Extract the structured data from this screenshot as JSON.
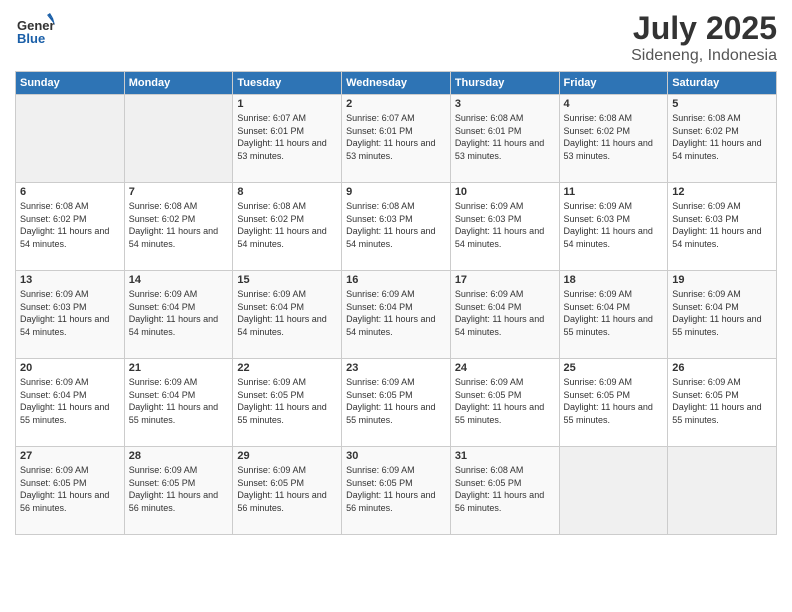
{
  "header": {
    "logo_general": "General",
    "logo_blue": "Blue",
    "title": "July 2025",
    "location": "Sideneng, Indonesia"
  },
  "days_of_week": [
    "Sunday",
    "Monday",
    "Tuesday",
    "Wednesday",
    "Thursday",
    "Friday",
    "Saturday"
  ],
  "weeks": [
    [
      {
        "day": "",
        "empty": true
      },
      {
        "day": "",
        "empty": true
      },
      {
        "day": "1",
        "sunrise": "Sunrise: 6:07 AM",
        "sunset": "Sunset: 6:01 PM",
        "daylight": "Daylight: 11 hours and 53 minutes."
      },
      {
        "day": "2",
        "sunrise": "Sunrise: 6:07 AM",
        "sunset": "Sunset: 6:01 PM",
        "daylight": "Daylight: 11 hours and 53 minutes."
      },
      {
        "day": "3",
        "sunrise": "Sunrise: 6:08 AM",
        "sunset": "Sunset: 6:01 PM",
        "daylight": "Daylight: 11 hours and 53 minutes."
      },
      {
        "day": "4",
        "sunrise": "Sunrise: 6:08 AM",
        "sunset": "Sunset: 6:02 PM",
        "daylight": "Daylight: 11 hours and 53 minutes."
      },
      {
        "day": "5",
        "sunrise": "Sunrise: 6:08 AM",
        "sunset": "Sunset: 6:02 PM",
        "daylight": "Daylight: 11 hours and 54 minutes."
      }
    ],
    [
      {
        "day": "6",
        "sunrise": "Sunrise: 6:08 AM",
        "sunset": "Sunset: 6:02 PM",
        "daylight": "Daylight: 11 hours and 54 minutes."
      },
      {
        "day": "7",
        "sunrise": "Sunrise: 6:08 AM",
        "sunset": "Sunset: 6:02 PM",
        "daylight": "Daylight: 11 hours and 54 minutes."
      },
      {
        "day": "8",
        "sunrise": "Sunrise: 6:08 AM",
        "sunset": "Sunset: 6:02 PM",
        "daylight": "Daylight: 11 hours and 54 minutes."
      },
      {
        "day": "9",
        "sunrise": "Sunrise: 6:08 AM",
        "sunset": "Sunset: 6:03 PM",
        "daylight": "Daylight: 11 hours and 54 minutes."
      },
      {
        "day": "10",
        "sunrise": "Sunrise: 6:09 AM",
        "sunset": "Sunset: 6:03 PM",
        "daylight": "Daylight: 11 hours and 54 minutes."
      },
      {
        "day": "11",
        "sunrise": "Sunrise: 6:09 AM",
        "sunset": "Sunset: 6:03 PM",
        "daylight": "Daylight: 11 hours and 54 minutes."
      },
      {
        "day": "12",
        "sunrise": "Sunrise: 6:09 AM",
        "sunset": "Sunset: 6:03 PM",
        "daylight": "Daylight: 11 hours and 54 minutes."
      }
    ],
    [
      {
        "day": "13",
        "sunrise": "Sunrise: 6:09 AM",
        "sunset": "Sunset: 6:03 PM",
        "daylight": "Daylight: 11 hours and 54 minutes."
      },
      {
        "day": "14",
        "sunrise": "Sunrise: 6:09 AM",
        "sunset": "Sunset: 6:04 PM",
        "daylight": "Daylight: 11 hours and 54 minutes."
      },
      {
        "day": "15",
        "sunrise": "Sunrise: 6:09 AM",
        "sunset": "Sunset: 6:04 PM",
        "daylight": "Daylight: 11 hours and 54 minutes."
      },
      {
        "day": "16",
        "sunrise": "Sunrise: 6:09 AM",
        "sunset": "Sunset: 6:04 PM",
        "daylight": "Daylight: 11 hours and 54 minutes."
      },
      {
        "day": "17",
        "sunrise": "Sunrise: 6:09 AM",
        "sunset": "Sunset: 6:04 PM",
        "daylight": "Daylight: 11 hours and 54 minutes."
      },
      {
        "day": "18",
        "sunrise": "Sunrise: 6:09 AM",
        "sunset": "Sunset: 6:04 PM",
        "daylight": "Daylight: 11 hours and 55 minutes."
      },
      {
        "day": "19",
        "sunrise": "Sunrise: 6:09 AM",
        "sunset": "Sunset: 6:04 PM",
        "daylight": "Daylight: 11 hours and 55 minutes."
      }
    ],
    [
      {
        "day": "20",
        "sunrise": "Sunrise: 6:09 AM",
        "sunset": "Sunset: 6:04 PM",
        "daylight": "Daylight: 11 hours and 55 minutes."
      },
      {
        "day": "21",
        "sunrise": "Sunrise: 6:09 AM",
        "sunset": "Sunset: 6:04 PM",
        "daylight": "Daylight: 11 hours and 55 minutes."
      },
      {
        "day": "22",
        "sunrise": "Sunrise: 6:09 AM",
        "sunset": "Sunset: 6:05 PM",
        "daylight": "Daylight: 11 hours and 55 minutes."
      },
      {
        "day": "23",
        "sunrise": "Sunrise: 6:09 AM",
        "sunset": "Sunset: 6:05 PM",
        "daylight": "Daylight: 11 hours and 55 minutes."
      },
      {
        "day": "24",
        "sunrise": "Sunrise: 6:09 AM",
        "sunset": "Sunset: 6:05 PM",
        "daylight": "Daylight: 11 hours and 55 minutes."
      },
      {
        "day": "25",
        "sunrise": "Sunrise: 6:09 AM",
        "sunset": "Sunset: 6:05 PM",
        "daylight": "Daylight: 11 hours and 55 minutes."
      },
      {
        "day": "26",
        "sunrise": "Sunrise: 6:09 AM",
        "sunset": "Sunset: 6:05 PM",
        "daylight": "Daylight: 11 hours and 55 minutes."
      }
    ],
    [
      {
        "day": "27",
        "sunrise": "Sunrise: 6:09 AM",
        "sunset": "Sunset: 6:05 PM",
        "daylight": "Daylight: 11 hours and 56 minutes."
      },
      {
        "day": "28",
        "sunrise": "Sunrise: 6:09 AM",
        "sunset": "Sunset: 6:05 PM",
        "daylight": "Daylight: 11 hours and 56 minutes."
      },
      {
        "day": "29",
        "sunrise": "Sunrise: 6:09 AM",
        "sunset": "Sunset: 6:05 PM",
        "daylight": "Daylight: 11 hours and 56 minutes."
      },
      {
        "day": "30",
        "sunrise": "Sunrise: 6:09 AM",
        "sunset": "Sunset: 6:05 PM",
        "daylight": "Daylight: 11 hours and 56 minutes."
      },
      {
        "day": "31",
        "sunrise": "Sunrise: 6:08 AM",
        "sunset": "Sunset: 6:05 PM",
        "daylight": "Daylight: 11 hours and 56 minutes."
      },
      {
        "day": "",
        "empty": true
      },
      {
        "day": "",
        "empty": true
      }
    ]
  ]
}
